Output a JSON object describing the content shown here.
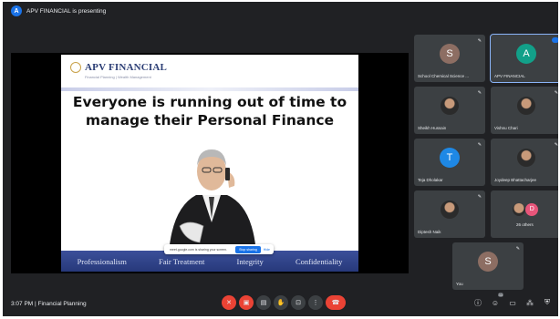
{
  "presenter": {
    "initial": "A",
    "text": "APV FINANCIAL is presenting"
  },
  "slide": {
    "logo_name": "APV FINANCIAL",
    "logo_tagline": "Financial Planning | Wealth Management",
    "title": "Everyone is running out of time to manage their Personal Finance",
    "values": [
      "Professionalism",
      "Fair Treatment",
      "Integrity",
      "Confidentiality"
    ],
    "share_notice": "meet.google.com is sharing your screen.",
    "stop_sharing": "Stop sharing",
    "hide": "Hide"
  },
  "participants": [
    {
      "name": "School Chemical Science ...",
      "initial": "S",
      "color": "#8d6e63",
      "type": "avatar"
    },
    {
      "name": "APV FINANCIAL",
      "initial": "A",
      "color": "#12a089",
      "type": "avatar"
    },
    {
      "name": "Sheikh Hussain",
      "type": "photo"
    },
    {
      "name": "Vishnu Chari",
      "type": "photo"
    },
    {
      "name": "Teja Dholakar",
      "initial": "T",
      "color": "#1e88e5",
      "type": "avatar"
    },
    {
      "name": "Joydeep Bhattacharjee",
      "type": "photo"
    },
    {
      "name": "Diptesh Naik",
      "type": "photo"
    },
    {
      "name": "26 others",
      "initial": "D",
      "color": "#e8557a",
      "type": "others"
    },
    {
      "name": "You",
      "initial": "S",
      "color": "#8d6e63",
      "type": "avatar"
    }
  ],
  "footer": {
    "time_title": "3:07 PM  |  Financial Planning",
    "people_count": "33"
  },
  "colors": {
    "background": "#202124",
    "tile": "#3c4043",
    "danger": "#ea4335",
    "accent": "#1a73e8"
  }
}
